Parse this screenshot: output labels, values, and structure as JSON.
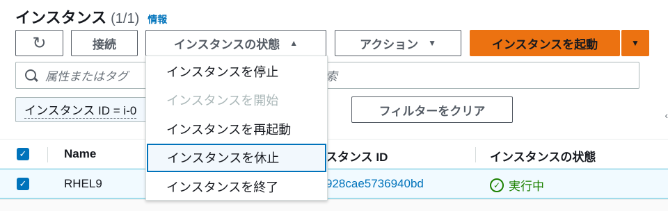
{
  "header": {
    "title": "インスタンス",
    "count": "(1/1)",
    "info_link": "情報"
  },
  "toolbar": {
    "refresh_icon": "↻",
    "connect_label": "接続",
    "instance_state_label": "インスタンスの状態",
    "instance_state_caret": "▲",
    "actions_label": "アクション",
    "actions_caret": "▼",
    "launch_label": "インスタンスを起動",
    "launch_caret": "▼"
  },
  "search": {
    "text_left": "属性またはタグ",
    "text_right": "ス を検索"
  },
  "filter": {
    "chip_label": "インスタンス ID = i-0",
    "clear_label": "フィルターをクリア",
    "edge_icon": "‹"
  },
  "table": {
    "header_check": "✓",
    "headers": {
      "name": "Name",
      "instance_id": "スタンス ID",
      "instance_state": "インスタンスの状態"
    },
    "rows": [
      {
        "check": "✓",
        "name": "RHEL9",
        "instance_id": "928cae5736940bd",
        "state_icon": "✓",
        "state": "実行中"
      }
    ]
  },
  "state_menu": {
    "items": [
      {
        "label": "インスタンスを停止",
        "disabled": false
      },
      {
        "label": "インスタンスを開始",
        "disabled": true
      },
      {
        "label": "インスタンスを再起動",
        "disabled": false
      },
      {
        "label": "インスタンスを休止",
        "disabled": false
      },
      {
        "label": "インスタンスを終了",
        "disabled": false
      }
    ]
  }
}
